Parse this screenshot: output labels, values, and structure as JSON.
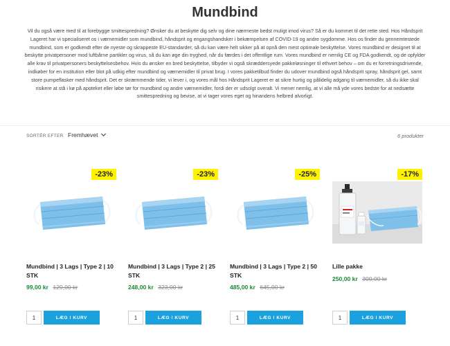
{
  "page": {
    "title": "Mundbind",
    "description": "Vil du også være med til at forebygge smittespredning? Ønsker du at beskytte dig selv og dine nærmeste bedst muligt imod virus? Så er du kommet til det rette sted. Hos Håndsprit Lageret har vi specialiseret os i værnemidler som mundbind, håndsprit og engangshandsker i bekæmpelsen af COVID-19 og andre sygdomme. Hos os finder du gennemtestede mundbind, som er godkendt efter de nyeste og skrappeste EU-standarder, så du kan være helt sikker på at opnå den mest optimale beskyttelse. Vores mundbind er designet til at beskytte privatpersoner mod luftbårne partikler og virus, så du kan øge din tryghed, når du færdes i det offentlige rum. Vores mundbind er nemlig CE og FDA godkendt, og de opfylder alle krav til privatpersoners beskyttelsesbehov. Hvis du ønsker en bred beskyttelse, tilbyder vi også skræddersyede pakkeløsninger til ethvert behov – om du er forretningsdrivende, indkøber for en institution eller blot på udkig efter mundbind og værnemidler til privat brug. I vores pakketilbud finder du udover mundbind også håndsprit spray, håndsprit gel, samt store pumpeflasker med håndsprit. Det er skræmmende tider, vi lever i, og vores mål hos Håndsprit Lageret er at sikre hurtig og pålidelig adgang til værnemidler, så du ikke skal risikere at stå i kø på apoteket eller løbe tør for mundbind og andre værnemidler, fordi der er udsolgt overalt. Vi mener nemlig, at vi alle må yde vores bedste for at nedsætte smittespredning og bevise, at vi tager vores eget og hinandens helbred alvorligt."
  },
  "toolbar": {
    "sort_label": "SORTÉR EFTER",
    "sort_value": "Fremhævet",
    "count": "6 produkter"
  },
  "products": [
    {
      "name": "Mundbind | 3 Lags | Type 2 | 10 STK",
      "price": "99,00 kr",
      "old_price": "129,00 kr",
      "badge": "-23%",
      "image": "mask-image",
      "qty": "1",
      "button": "LÆG I KURV"
    },
    {
      "name": "Mundbind | 3 Lags | Type 2 | 25 STK",
      "price": "248,00 kr",
      "old_price": "323,00 kr",
      "badge": "-23%",
      "image": "mask-image",
      "qty": "1",
      "button": "LÆG I KURV"
    },
    {
      "name": "Mundbind | 3 Lags | Type 2 | 50 STK",
      "price": "485,00 kr",
      "old_price": "645,00 kr",
      "badge": "-25%",
      "image": "mask-image",
      "qty": "1",
      "button": "LÆG I KURV"
    },
    {
      "name": "Lille pakke",
      "price": "250,00 kr",
      "old_price": "300,00 kr",
      "badge": "-17%",
      "image": "package-image",
      "qty": "1",
      "button": "LÆG I KURV"
    }
  ],
  "colors": {
    "accent": "#1ba1dd",
    "badge": "#fff200",
    "sale_price": "#1a8a34",
    "mask": "#7ec0ea"
  }
}
